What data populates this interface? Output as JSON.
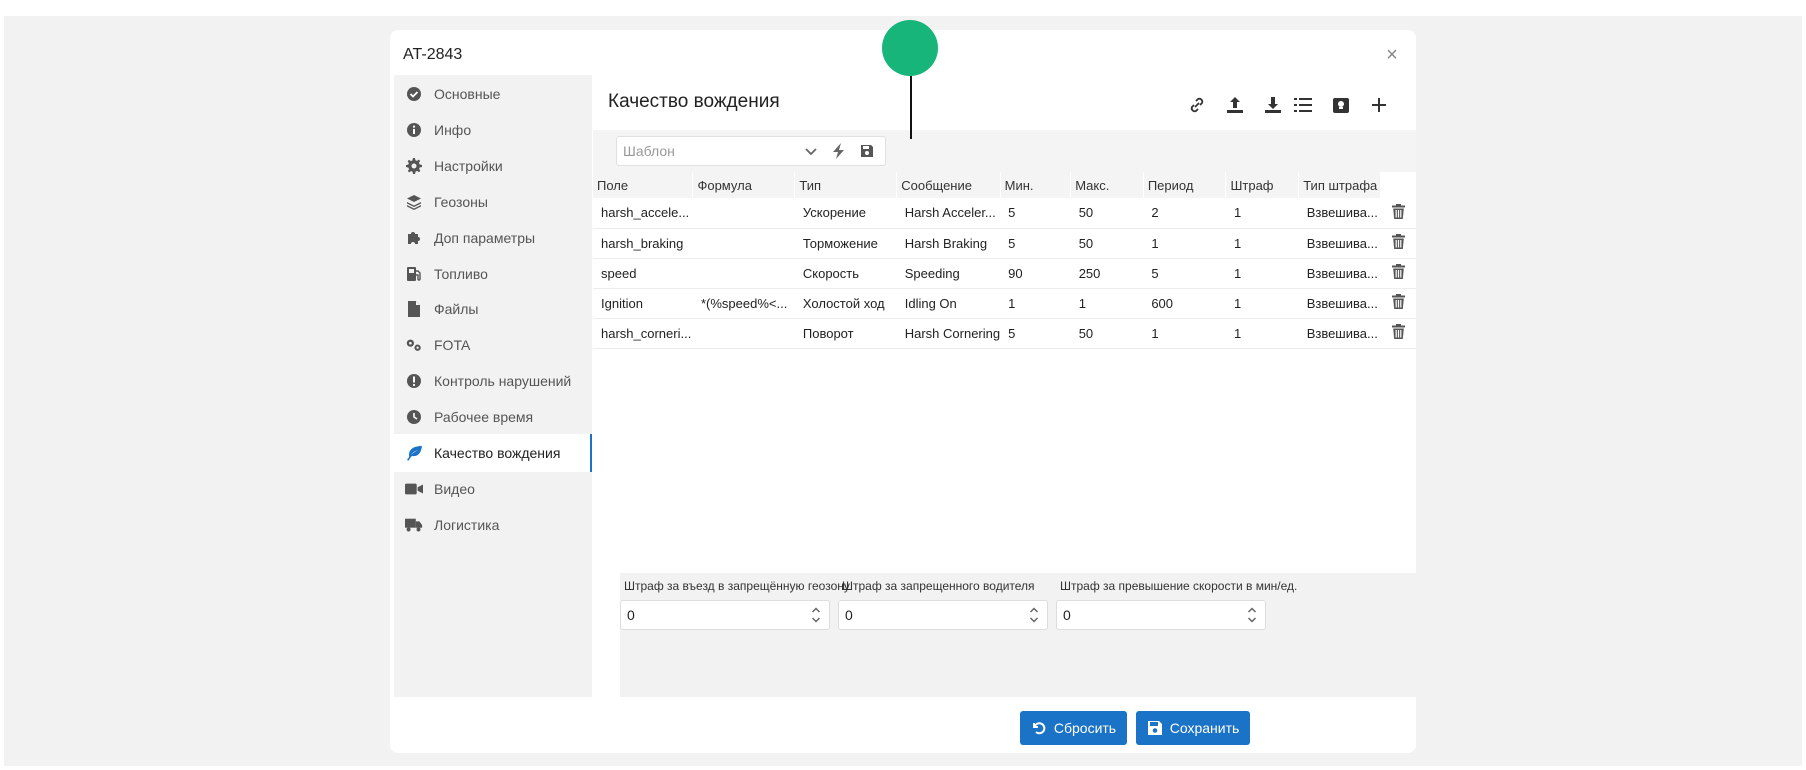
{
  "dialog": {
    "title": "AT-2843",
    "close_glyph": "×"
  },
  "sidebar": {
    "items": [
      {
        "label": "Основные",
        "icon": "check-circle-icon"
      },
      {
        "label": "Инфо",
        "icon": "info-circle-icon"
      },
      {
        "label": "Настройки",
        "icon": "gear-icon"
      },
      {
        "label": "Геозоны",
        "icon": "layers-icon"
      },
      {
        "label": "Доп параметры",
        "icon": "puzzle-icon"
      },
      {
        "label": "Топливо",
        "icon": "fuel-pump-icon"
      },
      {
        "label": "Файлы",
        "icon": "file-icon"
      },
      {
        "label": "FOTA",
        "icon": "gears-icon"
      },
      {
        "label": "Контроль нарушений",
        "icon": "exclamation-circle-icon"
      },
      {
        "label": "Рабочее время",
        "icon": "clock-icon"
      },
      {
        "label": "Качество вождения",
        "icon": "leaf-icon",
        "active": true
      },
      {
        "label": "Видео",
        "icon": "video-camera-icon"
      },
      {
        "label": "Логистика",
        "icon": "truck-icon"
      }
    ]
  },
  "main": {
    "title": "Качество вождения",
    "toolbar_icons": [
      "link-icon",
      "upload-icon",
      "download-icon",
      "list-icon",
      "clipboard-icon",
      "plus-icon"
    ],
    "template": {
      "placeholder": "Шаблон",
      "value": ""
    },
    "table": {
      "columns": [
        "Поле",
        "Формула",
        "Тип",
        "Сообщение",
        "Мин.",
        "Макс.",
        "Период",
        "Штраф",
        "Тип штрафа"
      ],
      "rows": [
        [
          "harsh_accele...",
          "",
          "Ускорение",
          "Harsh Acceler...",
          "5",
          "50",
          "2",
          "1",
          "Взвешива..."
        ],
        [
          "harsh_braking",
          "",
          "Торможение",
          "Harsh Braking",
          "5",
          "50",
          "1",
          "1",
          "Взвешива..."
        ],
        [
          "speed",
          "",
          "Скорость",
          "Speeding",
          "90",
          "250",
          "5",
          "1",
          "Взвешива..."
        ],
        [
          "Ignition",
          "*(%speed%<...",
          "Холостой ход",
          "Idling On",
          "1",
          "1",
          "600",
          "1",
          "Взвешива..."
        ],
        [
          "harsh_corneri...",
          "",
          "Поворот",
          "Harsh Cornering",
          "5",
          "50",
          "1",
          "1",
          "Взвешива..."
        ]
      ]
    },
    "penalties": [
      {
        "label": "Штраф за въезд в запрещённую геозону",
        "value": "0"
      },
      {
        "label": "Штраф за запрещенного водителя",
        "value": "0"
      },
      {
        "label": "Штраф за превышение скорости в мин/ед.",
        "value": "0"
      }
    ]
  },
  "footer": {
    "reset_label": "Сбросить",
    "save_label": "Сохранить"
  },
  "colors": {
    "accent": "#1a73c7",
    "marker": "#17b57a"
  }
}
